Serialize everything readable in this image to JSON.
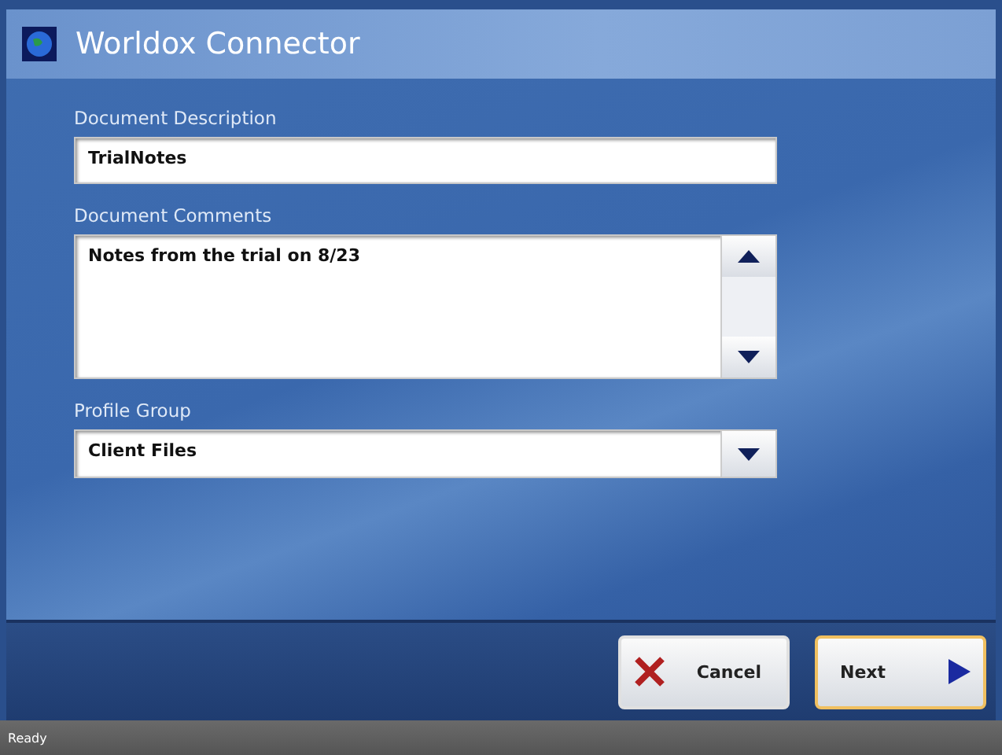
{
  "window": {
    "title": "Worldox Connector"
  },
  "fields": [
    {
      "kind": "text",
      "label": "Document Description",
      "value": "TrialNotes"
    },
    {
      "kind": "memo",
      "label": "Document Comments",
      "value": "Notes from the trial on 8/23"
    },
    {
      "kind": "combo",
      "label": "Profile Group",
      "value": "Client Files"
    }
  ],
  "buttons": [
    {
      "kind": "cancel",
      "label": "Cancel",
      "focused": false
    },
    {
      "kind": "next",
      "label": "Next",
      "focused": true
    }
  ],
  "status_bar": {
    "text": "Ready"
  }
}
